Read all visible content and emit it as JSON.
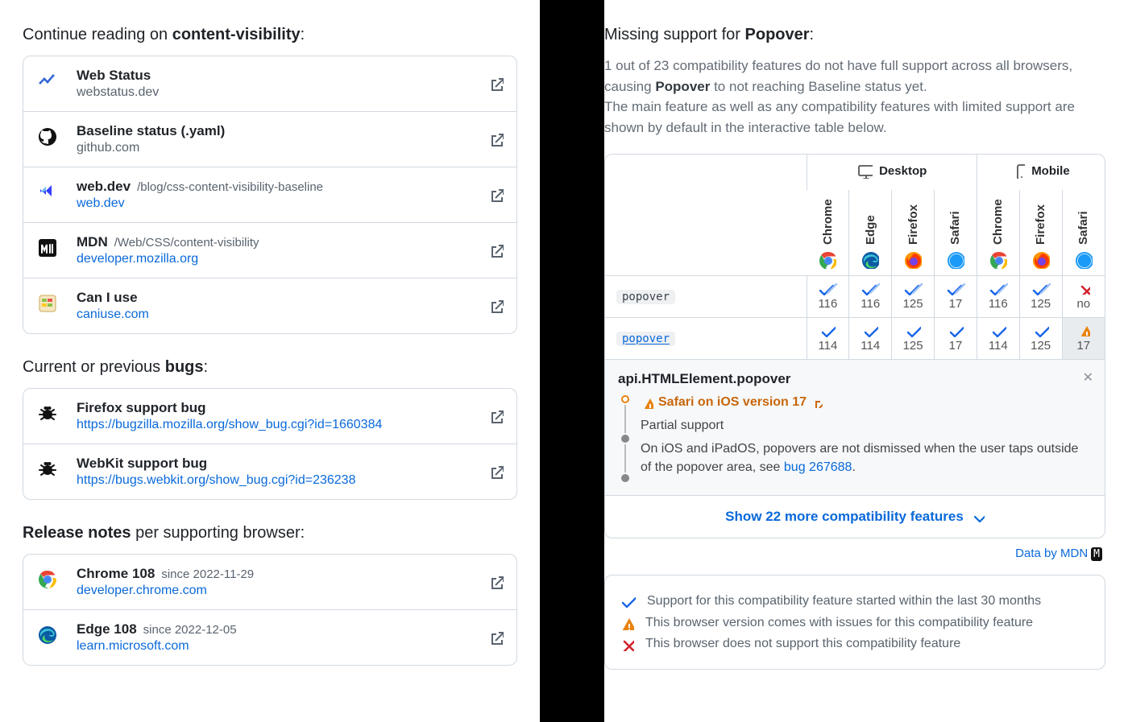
{
  "left": {
    "continue_reading": {
      "prefix": "Continue reading on ",
      "strong": "content-visibility",
      "suffix": ":",
      "items": [
        {
          "icon": "webstatus",
          "title": "Web Status",
          "path": "",
          "sub": "webstatus.dev",
          "sub_is_link": false
        },
        {
          "icon": "github",
          "title": "Baseline status (.yaml)",
          "path": "",
          "sub": "github.com",
          "sub_is_link": false
        },
        {
          "icon": "webdev",
          "title": "web.dev",
          "path": "/blog/css-content-visibility-baseline",
          "sub": "web.dev",
          "sub_is_link": true
        },
        {
          "icon": "mdn",
          "title": "MDN",
          "path": "/Web/CSS/content-visibility",
          "sub": "developer.mozilla.org",
          "sub_is_link": true
        },
        {
          "icon": "caniuse",
          "title": "Can I use",
          "path": "",
          "sub": "caniuse.com",
          "sub_is_link": true
        }
      ]
    },
    "bugs": {
      "prefix": "Current or previous ",
      "strong": "bugs",
      "suffix": ":",
      "items": [
        {
          "icon": "bug",
          "title": "Firefox support bug",
          "sub": "https://bugzilla.mozilla.org/show_bug.cgi?id=1660384"
        },
        {
          "icon": "bug",
          "title": "WebKit support bug",
          "sub": "https://bugs.webkit.org/show_bug.cgi?id=236238"
        }
      ]
    },
    "release_notes": {
      "strong": "Release notes",
      "rest": " per supporting browser:",
      "items": [
        {
          "icon": "chrome",
          "title": "Chrome 108",
          "since": "since 2022-11-29",
          "sub": "developer.chrome.com"
        },
        {
          "icon": "edge",
          "title": "Edge 108",
          "since": "since 2022-12-05",
          "sub": "learn.microsoft.com"
        }
      ]
    }
  },
  "right": {
    "heading_prefix": "Missing support for ",
    "heading_strong": "Popover",
    "heading_suffix": ":",
    "intro_line1_a": "1 out of 23 compatibility features do not have full support across all browsers, causing ",
    "intro_line1_b": "Popover",
    "intro_line1_c": " to not reaching Baseline status yet.",
    "intro_line2": "The main feature as well as any compatibility features with limited support are shown by default in the interactive table below.",
    "platforms": {
      "desktop": "Desktop",
      "mobile": "Mobile"
    },
    "browsers": [
      {
        "name": "Chrome",
        "icon": "chrome",
        "group": "desktop"
      },
      {
        "name": "Edge",
        "icon": "edge",
        "group": "desktop"
      },
      {
        "name": "Firefox",
        "icon": "firefox",
        "group": "desktop"
      },
      {
        "name": "Safari",
        "icon": "safari",
        "group": "desktop"
      },
      {
        "name": "Chrome",
        "icon": "chrome",
        "group": "mobile"
      },
      {
        "name": "Firefox",
        "icon": "firefox",
        "group": "mobile"
      },
      {
        "name": "Safari",
        "icon": "safari",
        "group": "mobile"
      }
    ],
    "rows": [
      {
        "label": "popover",
        "is_link": false,
        "cells": [
          {
            "status": "recent",
            "ver": "116"
          },
          {
            "status": "recent",
            "ver": "116"
          },
          {
            "status": "recent",
            "ver": "125"
          },
          {
            "status": "recent",
            "ver": "17"
          },
          {
            "status": "recent",
            "ver": "116"
          },
          {
            "status": "recent",
            "ver": "125"
          },
          {
            "status": "no",
            "ver": "no"
          }
        ]
      },
      {
        "label": "popover",
        "is_link": true,
        "cells": [
          {
            "status": "yes",
            "ver": "114"
          },
          {
            "status": "yes",
            "ver": "114"
          },
          {
            "status": "yes",
            "ver": "125"
          },
          {
            "status": "yes",
            "ver": "17"
          },
          {
            "status": "yes",
            "ver": "114"
          },
          {
            "status": "yes",
            "ver": "125"
          },
          {
            "status": "warn",
            "ver": "17",
            "selected": true
          }
        ]
      }
    ],
    "detail": {
      "title": "api.HTMLElement.popover",
      "head": "Safari on iOS version 17",
      "partial": "Partial support",
      "note_a": "On iOS and iPadOS, popovers are not dismissed when the user taps outside of the popover area, see ",
      "note_link": "bug 267688",
      "note_b": "."
    },
    "show_more": "Show 22 more compatibility features",
    "data_by": "Data by MDN",
    "legend": {
      "yes": "Support for this compatibility feature started within the last 30 months",
      "warn": "This browser version comes with issues for this compatibility feature",
      "no": "This browser does not support this compatibility feature"
    }
  }
}
